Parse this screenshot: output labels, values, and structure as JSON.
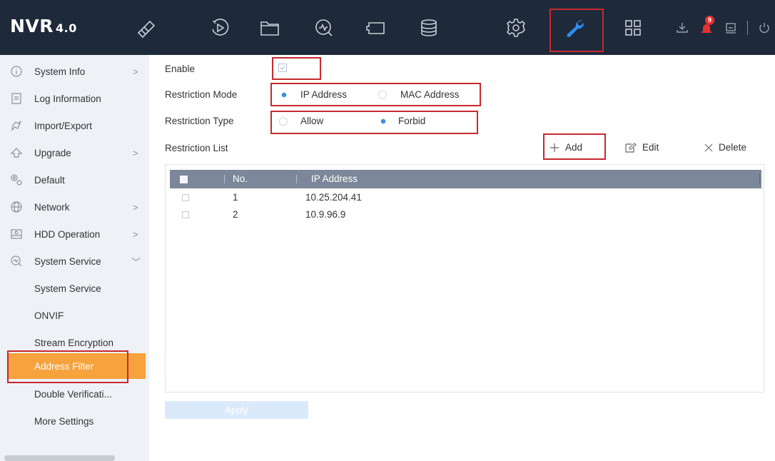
{
  "app": {
    "logo": "NVR",
    "version": "4.0"
  },
  "topbar": {
    "nav_icons": [
      "live-view-icon",
      "playback-icon",
      "file-management-icon",
      "smart-analysis-icon",
      "camera-icon",
      "storage-icon",
      "system-settings-icon",
      "maintenance-icon",
      "grid-icon"
    ],
    "active_nav": "maintenance-icon",
    "alarm_count": "9"
  },
  "sidebar": {
    "items": [
      {
        "label": "System Info",
        "arrow": ">"
      },
      {
        "label": "Log Information",
        "arrow": ""
      },
      {
        "label": "Import/Export",
        "arrow": ""
      },
      {
        "label": "Upgrade",
        "arrow": ">"
      },
      {
        "label": "Default",
        "arrow": ""
      },
      {
        "label": "Network",
        "arrow": ">"
      },
      {
        "label": "HDD Operation",
        "arrow": ">"
      },
      {
        "label": "System Service",
        "arrow": "﹀"
      }
    ],
    "sub_items": [
      {
        "label": "System Service"
      },
      {
        "label": "ONVIF"
      },
      {
        "label": "Stream Encryption"
      },
      {
        "label": "Address Filter"
      },
      {
        "label": "Double Verificati..."
      },
      {
        "label": "More Settings"
      }
    ],
    "active_sub": "Address Filter"
  },
  "form": {
    "enable_label": "Enable",
    "enable_checked": true,
    "restriction_mode_label": "Restriction Mode",
    "mode_options": [
      "IP Address",
      "MAC Address"
    ],
    "mode_selected": "IP Address",
    "restriction_type_label": "Restriction Type",
    "type_options": [
      "Allow",
      "Forbid"
    ],
    "type_selected": "Forbid",
    "restriction_list_label": "Restriction List"
  },
  "toolbar": {
    "add_label": "Add",
    "edit_label": "Edit",
    "delete_label": "Delete"
  },
  "table": {
    "headers": {
      "no": "No.",
      "address": "IP Address"
    },
    "rows": [
      {
        "no": "1",
        "address": "10.25.204.41"
      },
      {
        "no": "2",
        "address": "10.9.96.9"
      }
    ]
  },
  "apply_label": "Apply",
  "colors": {
    "topbar": "#1e2a3a",
    "active_icon": "#2f8ff0",
    "active_menu": "#f6a23d",
    "highlight_box": "#c8282e",
    "table_header": "#7c8899"
  }
}
